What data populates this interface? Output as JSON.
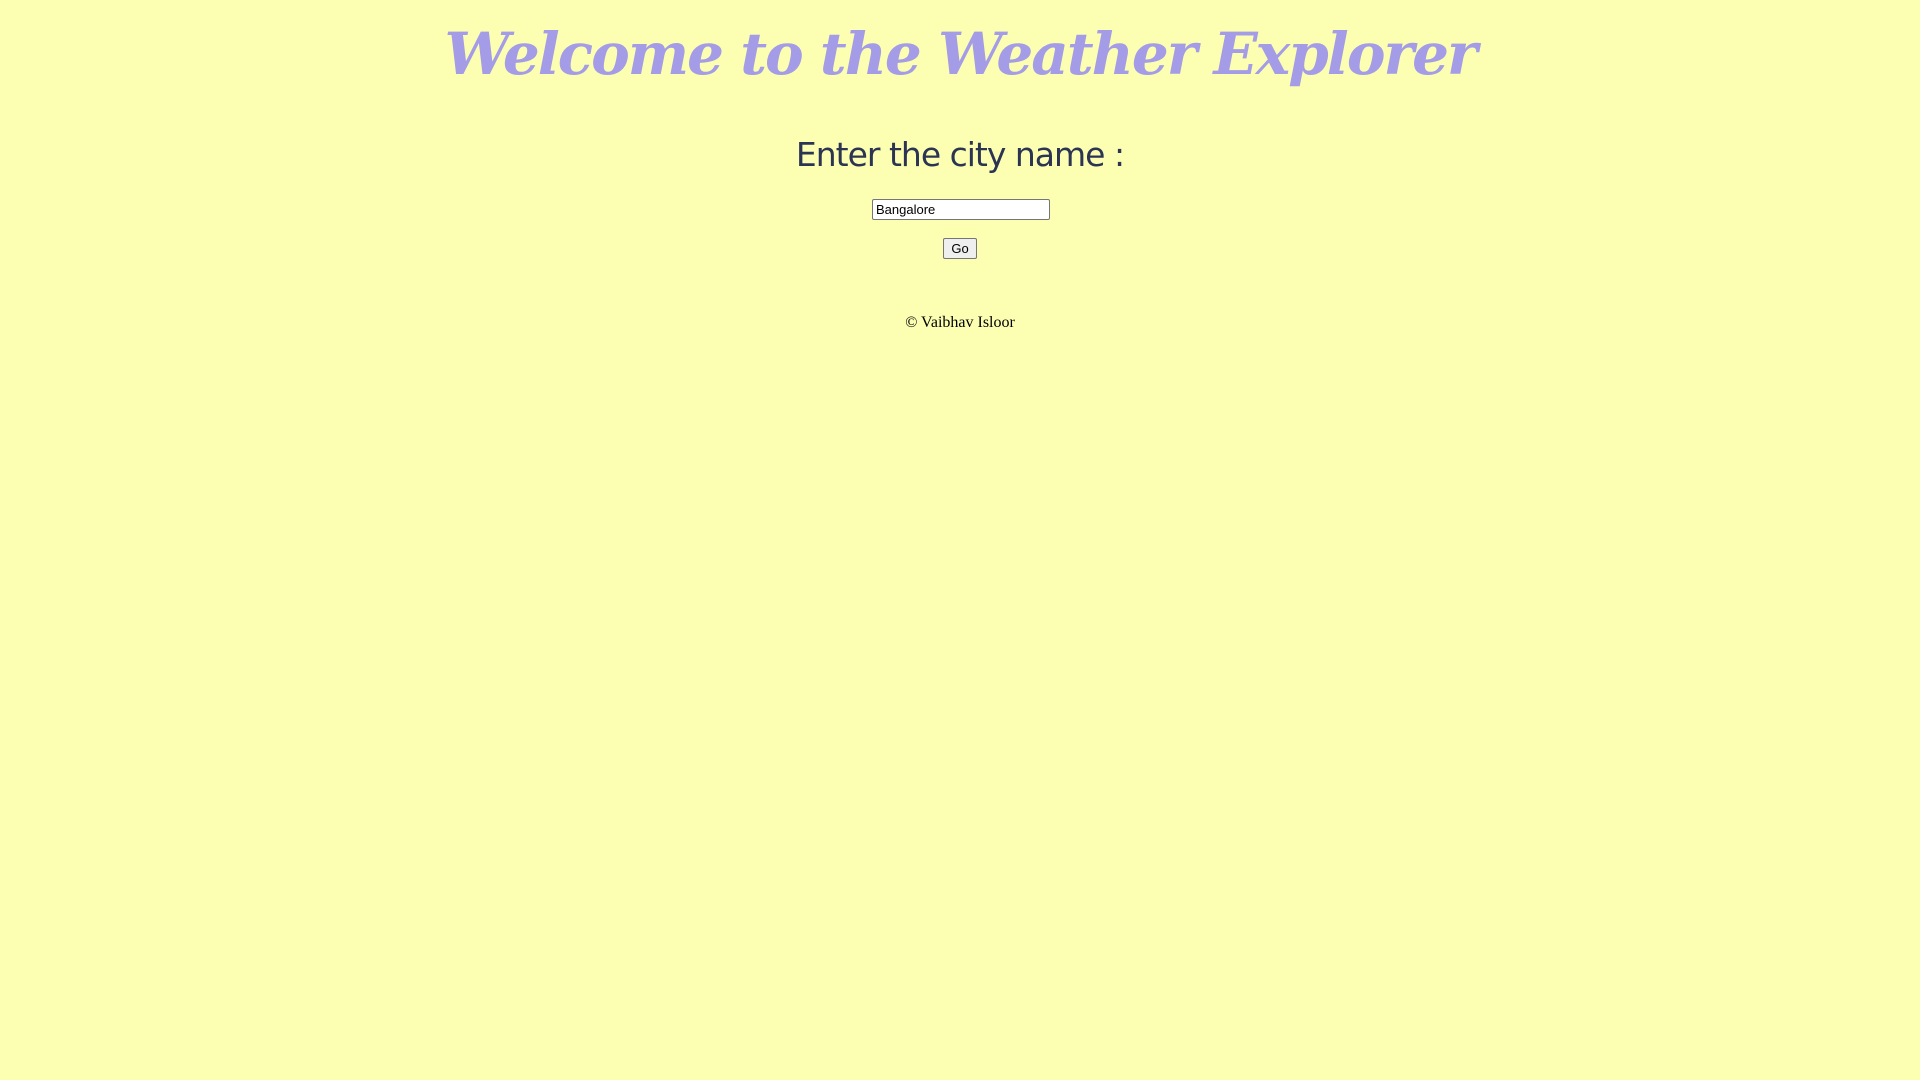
{
  "header": {
    "title": "Welcome to the Weather Explorer"
  },
  "form": {
    "prompt": "Enter the city name :",
    "city_input": {
      "value": "Bangalore",
      "placeholder": ""
    },
    "go_label": "Go"
  },
  "footer": {
    "copyright": "© Vaibhav Isloor"
  },
  "colors": {
    "background": "#fcffb2",
    "title": "#a49ce6",
    "prompt": "#2c3454"
  }
}
